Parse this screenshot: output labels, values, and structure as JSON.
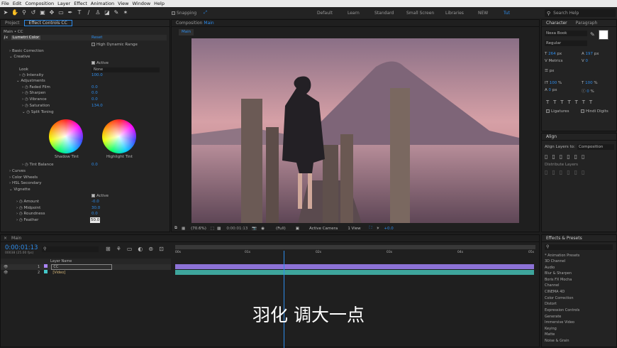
{
  "menu": [
    "File",
    "Edit",
    "Composition",
    "Layer",
    "Effect",
    "Animation",
    "View",
    "Window",
    "Help"
  ],
  "toolbar": {
    "snapping": "Snapping"
  },
  "workspaces": [
    "Default",
    "Learn",
    "Standard",
    "Small Screen",
    "Libraries",
    "NEW",
    "Tut"
  ],
  "search_help": "Search Help",
  "project_tab": "Project",
  "effect_controls_tab": "Effect Controls CC",
  "ec_header": "Main • CC",
  "lumetri": {
    "effect_name": "Lumetri Color",
    "reset": "Reset",
    "hdr": "High Dynamic Range",
    "basic": "Basic Correction",
    "creative": "Creative",
    "active": "Active",
    "look_label": "Look",
    "look_value": "None",
    "intensity": {
      "label": "Intensity",
      "value": "100.0"
    },
    "adjustments": "Adjustments",
    "faded": {
      "label": "Faded Film",
      "value": "0.0"
    },
    "sharpen": {
      "label": "Sharpen",
      "value": "0.0"
    },
    "vibrance": {
      "label": "Vibrance",
      "value": "0.0"
    },
    "saturation": {
      "label": "Saturation",
      "value": "134.0"
    },
    "split": "Split Toning",
    "shadow_tint": "Shadow Tint",
    "highlight_tint": "Highlight Tint",
    "tint_balance": {
      "label": "Tint Balance",
      "value": "0.0"
    },
    "curves": "Curves",
    "color_wheels": "Color Wheels",
    "hsl": "HSL Secondary",
    "vignette": "Vignette",
    "amount": {
      "label": "Amount",
      "value": "-0.0"
    },
    "midpoint": {
      "label": "Midpoint",
      "value": "30.0"
    },
    "roundness": {
      "label": "Roundness",
      "value": "0.0"
    },
    "feather": {
      "label": "Feather",
      "value": "50.0"
    }
  },
  "composition": {
    "tab": "Composition",
    "name": "Main",
    "sub": "Main",
    "zoom": "(70.6%)",
    "time": "0:00:01:13",
    "res": "(Full)",
    "camera": "Active Camera",
    "view": "1 View",
    "exposure": "+0.0"
  },
  "character": {
    "tab": "Character",
    "tab2": "Paragraph",
    "font": "Nexa Book",
    "style": "Regular",
    "size": "264",
    "size_unit": "px",
    "leading": "197",
    "leading_unit": "px",
    "tracking": "0",
    "kern": "Metrics",
    "stroke": "px",
    "vscale": "100",
    "vscale_unit": "%",
    "hscale": "100",
    "hscale_unit": "%",
    "baseline": "0",
    "baseline_unit": "px",
    "tsume": "0",
    "tsume_unit": "%",
    "ligatures": "Ligatures",
    "hindi": "Hindi Digits"
  },
  "align": {
    "tab": "Align",
    "align_to_label": "Align Layers to:",
    "align_to": "Composition",
    "distribute": "Distribute Layers"
  },
  "timeline": {
    "tab": "Main",
    "timecode": "0:00:01:13",
    "frames": "00038 (25.00 fps)",
    "layer_name": "Layer Name",
    "layers": [
      {
        "num": "1",
        "name": "CC"
      },
      {
        "num": "2",
        "name": "[Video]"
      }
    ],
    "ticks": [
      "00s",
      "01s",
      "02s",
      "03s",
      "04s",
      "05s"
    ]
  },
  "effects": {
    "tab": "Effects & Presets",
    "items": [
      "* Animation Presets",
      "3D Channel",
      "Audio",
      "Blur & Sharpen",
      "Boris FX Mocha",
      "Channel",
      "CINEMA 4D",
      "Color Correction",
      "Distort",
      "Expression Controls",
      "Generate",
      "Immersive Video",
      "Keying",
      "Matte",
      "Noise & Grain"
    ]
  },
  "subtitle": "羽化 调大一点"
}
